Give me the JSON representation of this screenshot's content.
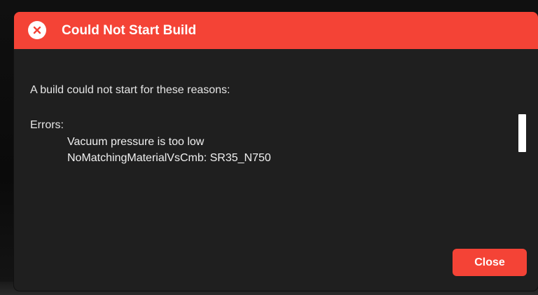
{
  "dialog": {
    "title": "Could Not Start Build",
    "header_icon": "close-circle-icon",
    "message": "A build could not start for these reasons:",
    "errors_heading": "Errors:",
    "errors": [
      "Vacuum pressure is too low",
      "NoMatchingMaterialVsCmb: SR35_N750"
    ],
    "close_label": "Close"
  },
  "colors": {
    "accent": "#f44336",
    "dialog_background": "#1f1f1f",
    "text": "#e6e6e6",
    "backdrop": "#0b0b0b"
  }
}
